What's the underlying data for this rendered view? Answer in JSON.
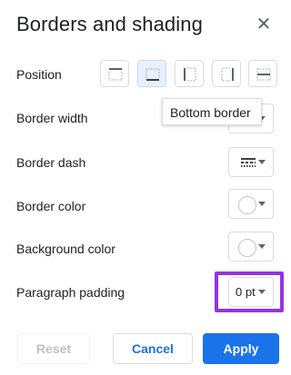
{
  "dialog": {
    "title": "Borders and shading",
    "close_icon": "close-icon"
  },
  "rows": {
    "position_label": "Position",
    "border_width_label": "Border width",
    "border_dash_label": "Border dash",
    "border_color_label": "Border color",
    "background_color_label": "Background color",
    "paragraph_padding_label": "Paragraph padding"
  },
  "position_buttons": [
    {
      "name": "top-border",
      "selected": false
    },
    {
      "name": "bottom-border",
      "selected": true
    },
    {
      "name": "left-border",
      "selected": false
    },
    {
      "name": "right-border",
      "selected": false
    },
    {
      "name": "between-border",
      "selected": false
    }
  ],
  "tooltip": {
    "text": "Bottom border"
  },
  "padding": {
    "value": "0 pt"
  },
  "buttons": {
    "reset": "Reset",
    "cancel": "Cancel",
    "apply": "Apply"
  },
  "colors": {
    "accent": "#1a73e8",
    "highlight": "#9334e6",
    "selected_bg": "#e8f0fe"
  }
}
